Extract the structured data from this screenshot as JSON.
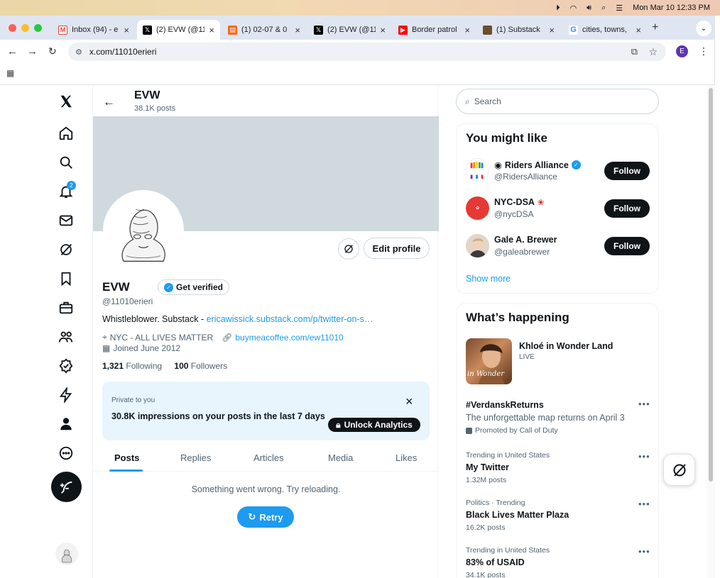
{
  "menubar": {
    "datetime": "Mon Mar 10  12:33 PM"
  },
  "browser": {
    "tabs": [
      {
        "label": "Inbox (94) - e",
        "icon_color": "#ea4335"
      },
      {
        "label": "(2) EVW (@11",
        "icon_color": "#000000"
      },
      {
        "label": "(1) 02-07 & 0",
        "icon_color": "#ff6719"
      },
      {
        "label": "(2) EVW (@11",
        "icon_color": "#000000"
      },
      {
        "label": "Border patrol",
        "icon_color": "#ff0000"
      },
      {
        "label": "(1) Substack",
        "icon_color": "#6b4e2e"
      },
      {
        "label": "cities, towns,",
        "icon_color": "#4285f4"
      }
    ],
    "url": "x.com/11010erieri",
    "profile_initial": "E"
  },
  "nav": {
    "notification_count": "2"
  },
  "header": {
    "name": "EVW",
    "posts_count": "38.1K posts"
  },
  "profile": {
    "name": "EVW",
    "get_verified": "Get verified",
    "handle": "@11010erieri",
    "bio_prefix": "Whistleblower. Substack - ",
    "bio_link": "ericawissick.substack.com/p/twitter-on-s…",
    "location": "NYC - ALL LIVES MATTER",
    "website": "buymeacoffee.com/ew11010",
    "joined": "Joined June 2012",
    "following_count": "1,321",
    "following_label": "Following",
    "followers_count": "100",
    "followers_label": "Followers",
    "edit_profile": "Edit profile"
  },
  "analytics": {
    "private_label": "Private to you",
    "impressions_text": "30.8K impressions on your posts in the last 7 days",
    "unlock_label": "Unlock Analytics"
  },
  "profile_tabs": [
    "Posts",
    "Replies",
    "Articles",
    "Media",
    "Likes"
  ],
  "feed": {
    "error": "Something went wrong. Try reloading.",
    "retry": "Retry"
  },
  "search": {
    "placeholder": "Search"
  },
  "suggestions": {
    "title": "You might like",
    "users": [
      {
        "name": "Riders Alliance",
        "handle": "@RidersAlliance",
        "follow": "Follow"
      },
      {
        "name": "NYC-DSA",
        "handle": "@nycDSA",
        "follow": "Follow"
      },
      {
        "name": "Gale A. Brewer",
        "handle": "@galeabrewer",
        "follow": "Follow"
      }
    ],
    "show_more": "Show more"
  },
  "trends": {
    "title": "What’s happening",
    "featured": {
      "title": "Khloé in Wonder Land",
      "status": "LIVE",
      "image_text": "in Wonder"
    },
    "items": [
      {
        "title": "#VerdanskReturns",
        "desc": "The unforgettable map returns on April 3",
        "promoted": "Promoted by Call of Duty"
      },
      {
        "context": "Trending in United States",
        "title": "My Twitter",
        "count": "1.32M posts"
      },
      {
        "context": "Politics · Trending",
        "title": "Black Lives Matter Plaza",
        "count": "16.2K posts"
      },
      {
        "context": "Trending in United States",
        "title": "83% of USAID",
        "count": "34.1K posts"
      }
    ]
  }
}
